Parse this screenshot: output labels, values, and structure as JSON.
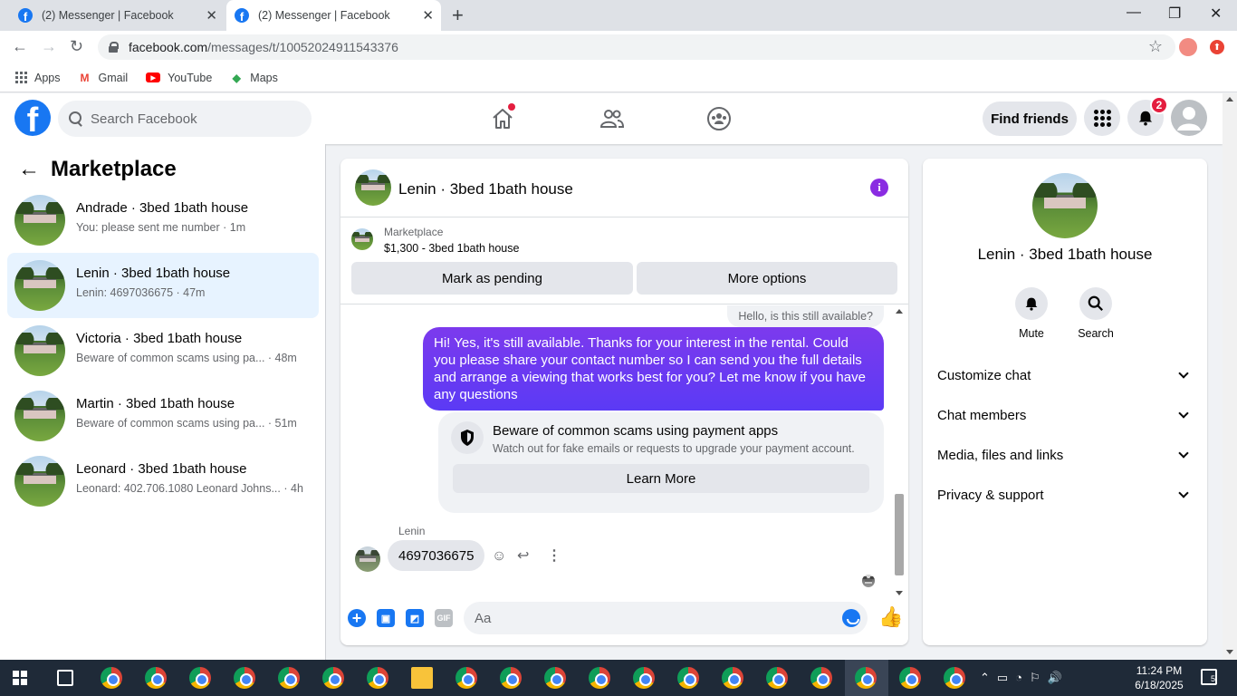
{
  "browser": {
    "tabs": [
      {
        "title": "(2) Messenger | Facebook",
        "active": false
      },
      {
        "title": "(2) Messenger | Facebook",
        "active": true
      }
    ],
    "url_host": "facebook.com",
    "url_path": "/messages/t/10052024911543376",
    "bookmarks": [
      {
        "label": "Apps",
        "icon": "apps-grid-icon"
      },
      {
        "label": "Gmail",
        "icon": "gmail-icon"
      },
      {
        "label": "YouTube",
        "icon": "youtube-icon"
      },
      {
        "label": "Maps",
        "icon": "maps-icon"
      }
    ]
  },
  "fb_header": {
    "logo": "f",
    "search_placeholder": "Search Facebook",
    "find_friends_label": "Find friends",
    "notification_count": "2"
  },
  "sidebar": {
    "title": "Marketplace",
    "conversations": [
      {
        "name": "Andrade · 3bed 1bath house",
        "snippet": "You: please sent me number · 1m",
        "active": false
      },
      {
        "name": "Lenin · 3bed 1bath house",
        "snippet": "Lenin: 4697036675 · 47m",
        "active": true
      },
      {
        "name": "Victoria · 3bed 1bath house",
        "snippet": "Beware of common scams using pa... · 48m",
        "active": false
      },
      {
        "name": "Martin · 3bed 1bath house",
        "snippet": "Beware of common scams using pa... · 51m",
        "active": false
      },
      {
        "name": "Leonard · 3bed 1bath house",
        "snippet": "Leonard: 402.706.1080 Leonard Johns... · 4h",
        "active": false
      }
    ]
  },
  "chat": {
    "title": "Lenin · 3bed 1bath house",
    "marketplace_label": "Marketplace",
    "listing": "$1,300 - 3bed 1bath house",
    "mark_pending_label": "Mark as pending",
    "more_options_label": "More options",
    "previous_message": "Hello, is this still available?",
    "sent_message": "Hi! Yes, it's still available. Thanks for your interest in the rental. Could you please share your contact number so I can send you the full details and arrange a viewing that works best for you? Let me know if you have any questions",
    "scam_title": "Beware of common scams using payment apps",
    "scam_subtitle": "Watch out for fake emails or requests to upgrade your payment account.",
    "learn_more_label": "Learn More",
    "sender_name": "Lenin",
    "received_message": "4697036675",
    "composer_placeholder": "Aa",
    "gif_label": "GIF"
  },
  "info_panel": {
    "name": "Lenin · 3bed 1bath house",
    "actions": [
      {
        "label": "Mute",
        "icon": "bell-icon"
      },
      {
        "label": "Search",
        "icon": "search-icon"
      }
    ],
    "sections": [
      {
        "label": "Customize chat"
      },
      {
        "label": "Chat members"
      },
      {
        "label": "Media, files and links"
      },
      {
        "label": "Privacy & support"
      }
    ]
  },
  "taskbar": {
    "time": "11:24 PM",
    "date": "6/18/2025",
    "notifications": "5"
  },
  "colors": {
    "fb_blue": "#1877f2",
    "sent_bubble": "#6a2cf5",
    "active_conversation": "#e7f3ff",
    "notification_red": "#e41e3f"
  }
}
